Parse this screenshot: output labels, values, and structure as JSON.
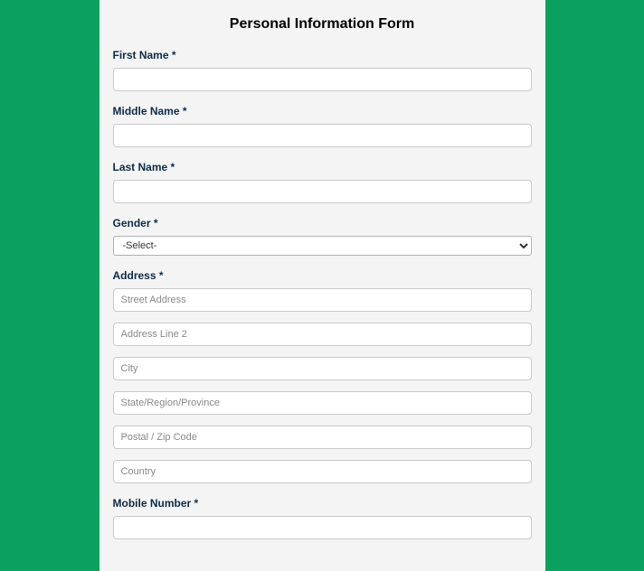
{
  "form": {
    "title": "Personal Information Form",
    "fields": {
      "firstName": {
        "label": "First Name *",
        "value": ""
      },
      "middleName": {
        "label": "Middle Name *",
        "value": ""
      },
      "lastName": {
        "label": "Last Name *",
        "value": ""
      },
      "gender": {
        "label": "Gender *",
        "selected": "-Select-"
      },
      "address": {
        "label": "Address *",
        "street": {
          "placeholder": "Street Address",
          "value": ""
        },
        "line2": {
          "placeholder": "Address Line 2",
          "value": ""
        },
        "city": {
          "placeholder": "City",
          "value": ""
        },
        "state": {
          "placeholder": "State/Region/Province",
          "value": ""
        },
        "postal": {
          "placeholder": "Postal / Zip Code",
          "value": ""
        },
        "country": {
          "placeholder": "Country",
          "value": ""
        }
      },
      "mobile": {
        "label": "Mobile Number *",
        "value": ""
      }
    }
  }
}
